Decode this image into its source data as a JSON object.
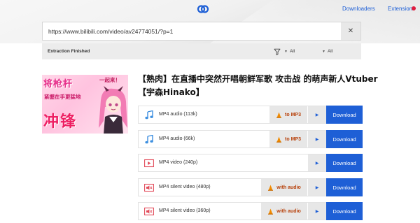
{
  "header": {
    "logo_icon": "link-chain-icon",
    "nav_downloaders": "Downloaders",
    "nav_extension": "Extension",
    "extension_badge_color": "#e01b3c"
  },
  "search": {
    "url_value": "https://www.bilibili.com/video/av24774051/?p=1",
    "clear_icon": "close-icon",
    "clear_label": "✕"
  },
  "status": {
    "text": "Extraction Finished",
    "filter_icon": "funnel-icon",
    "filter_type": "All",
    "filter_quality": "All"
  },
  "video": {
    "title": "【熟肉】在直播中突然开唱朝鲜军歌 攻击战 的萌声新人Vtuber【宇森Hinako】",
    "thumbnail": {
      "line1": "将枪杆",
      "line1b": "一起来！",
      "line2": "紧握在手更猛地",
      "line3": "冲锋"
    }
  },
  "formats": [
    {
      "label": "MP4 audio (113k)",
      "icon": "music-note-icon",
      "convert": "to MP3",
      "download": "Download"
    },
    {
      "label": "MP4 audio (66k)",
      "icon": "music-note-icon",
      "convert": "to MP3",
      "download": "Download"
    },
    {
      "label": "MP4 video (240p)",
      "icon": "video-player-icon",
      "convert": "",
      "download": "Download"
    },
    {
      "label": "MP4 silent video (480p)",
      "icon": "muted-video-icon",
      "convert": "with audio",
      "download": "Download"
    },
    {
      "label": "MP4 silent video (360p)",
      "icon": "muted-video-icon",
      "convert": "with audio",
      "download": "Download"
    }
  ],
  "colors": {
    "accent": "#1e5fd6",
    "convert_text": "#b7400a",
    "vlc_cone": "#f08a00"
  }
}
